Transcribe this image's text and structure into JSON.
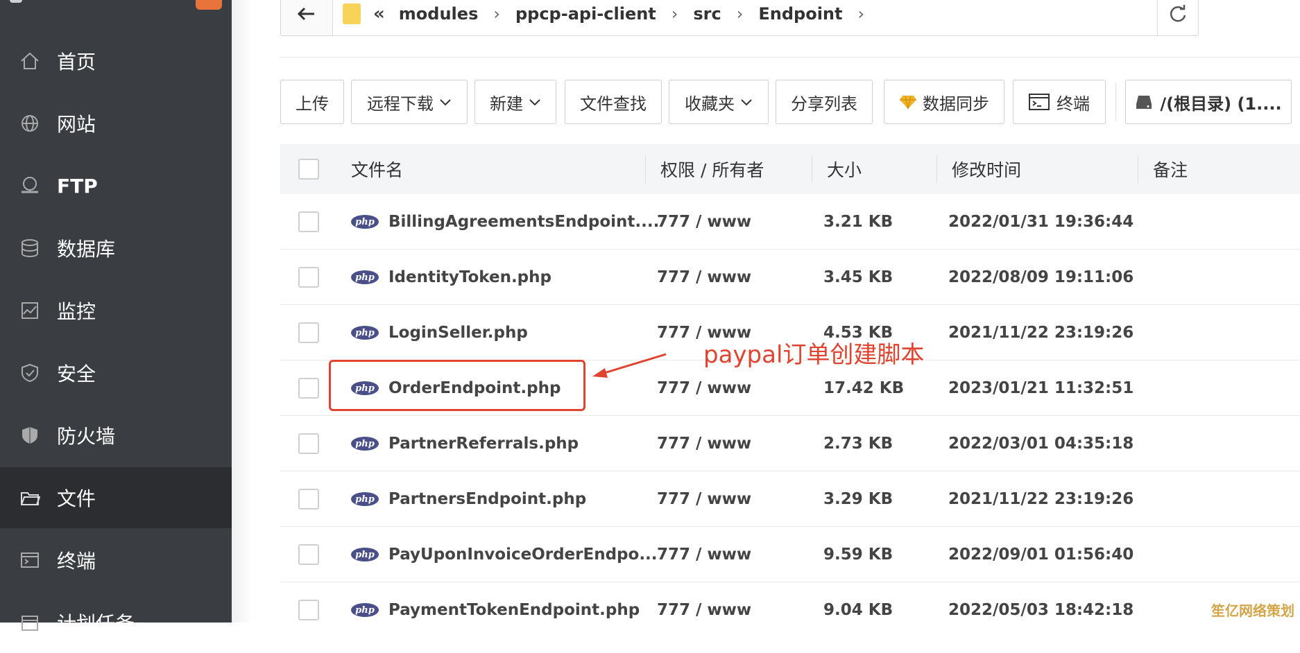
{
  "sidebar": {
    "items": [
      {
        "label": "首页",
        "icon": "home-icon"
      },
      {
        "label": "网站",
        "icon": "globe-icon"
      },
      {
        "label": "FTP",
        "icon": "ftp-icon"
      },
      {
        "label": "数据库",
        "icon": "database-icon"
      },
      {
        "label": "监控",
        "icon": "monitor-icon"
      },
      {
        "label": "安全",
        "icon": "shield-icon"
      },
      {
        "label": "防火墙",
        "icon": "firewall-icon"
      },
      {
        "label": "文件",
        "icon": "folder-icon"
      },
      {
        "label": "终端",
        "icon": "terminal-icon"
      },
      {
        "label": "计划任务",
        "icon": "calendar-icon"
      }
    ],
    "active_index": 7
  },
  "address_bar": {
    "crumbs": [
      "modules",
      "ppcp-api-client",
      "src",
      "Endpoint"
    ]
  },
  "toolbar": {
    "upload": "上传",
    "remote_download": "远程下载",
    "new": "新建",
    "file_search": "文件查找",
    "favorites": "收藏夹",
    "share_list": "分享列表",
    "data_sync": "数据同步",
    "terminal": "终端",
    "disk": "/(根目录) (1...."
  },
  "table": {
    "headers": {
      "name": "文件名",
      "perm": "权限 / 所有者",
      "size": "大小",
      "mtime": "修改时间",
      "note": "备注"
    },
    "icon_label": "php",
    "rows": [
      {
        "name": "BillingAgreementsEndpoint....",
        "perm": "777 / www",
        "size": "3.21 KB",
        "mtime": "2022/01/31 19:36:44"
      },
      {
        "name": "IdentityToken.php",
        "perm": "777 / www",
        "size": "3.45 KB",
        "mtime": "2022/08/09 19:11:06"
      },
      {
        "name": "LoginSeller.php",
        "perm": "777 / www",
        "size": "4.53 KB",
        "mtime": "2021/11/22 23:19:26"
      },
      {
        "name": "OrderEndpoint.php",
        "perm": "777 / www",
        "size": "17.42 KB",
        "mtime": "2023/01/21 11:32:51"
      },
      {
        "name": "PartnerReferrals.php",
        "perm": "777 / www",
        "size": "2.73 KB",
        "mtime": "2022/03/01 04:35:18"
      },
      {
        "name": "PartnersEndpoint.php",
        "perm": "777 / www",
        "size": "3.29 KB",
        "mtime": "2021/11/22 23:19:26"
      },
      {
        "name": "PayUponInvoiceOrderEndpo...",
        "perm": "777 / www",
        "size": "9.59 KB",
        "mtime": "2022/09/01 01:56:40"
      },
      {
        "name": "PaymentTokenEndpoint.php",
        "perm": "777 / www",
        "size": "9.04 KB",
        "mtime": "2022/05/03 18:42:18"
      }
    ]
  },
  "annotation": {
    "text": "paypal订单创建脚本",
    "color": "#e0432f"
  },
  "watermark": "笙亿网络策划"
}
